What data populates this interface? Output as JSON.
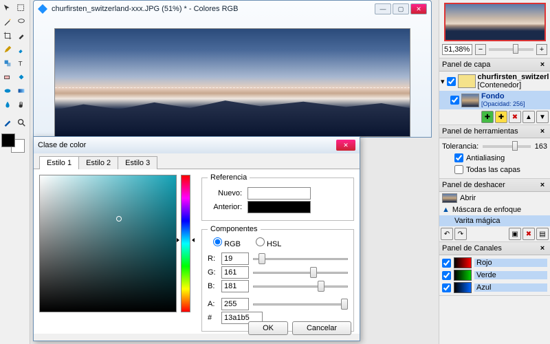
{
  "docwin": {
    "title": "churfirsten_switzerland-xxx.JPG (51%) * - Colores RGB"
  },
  "dialog": {
    "title": "Clase de color",
    "tabs": [
      "Estilo 1",
      "Estilo 2",
      "Estilo 3"
    ],
    "ref": {
      "legend": "Referencia",
      "new": "Nuevo:",
      "prev": "Anterior:",
      "new_color": "#13a1b5",
      "prev_color": "#000000"
    },
    "comp": {
      "legend": "Componentes",
      "rgb": "RGB",
      "hsl": "HSL",
      "r_label": "R:",
      "g_label": "G:",
      "b_label": "B:",
      "a_label": "A:",
      "hex_label": "#",
      "r": "19",
      "g": "161",
      "b": "181",
      "a": "255",
      "hex": "13a1b5"
    },
    "ok": "OK",
    "cancel": "Cancelar"
  },
  "panels": {
    "zoom": {
      "value": "51,38%"
    },
    "layers": {
      "title": "Panel de capa",
      "group_name": "churfirsten_switzerlan...",
      "group_sub": "[Contenedor]",
      "bg_name": "Fondo",
      "bg_op": "[Opacidad: 256]"
    },
    "tools": {
      "title": "Panel de herramientas",
      "tol_label": "Tolerancia:",
      "tol_value": "163",
      "aa": "Antialiasing",
      "all_layers": "Todas las capas"
    },
    "undo": {
      "title": "Panel de deshacer",
      "items": [
        "Abrir",
        "Máscara de enfoque",
        "Varita mágica"
      ]
    },
    "channels": {
      "title": "Panel de Canales",
      "r": "Rojo",
      "g": "Verde",
      "b": "Azul"
    }
  }
}
